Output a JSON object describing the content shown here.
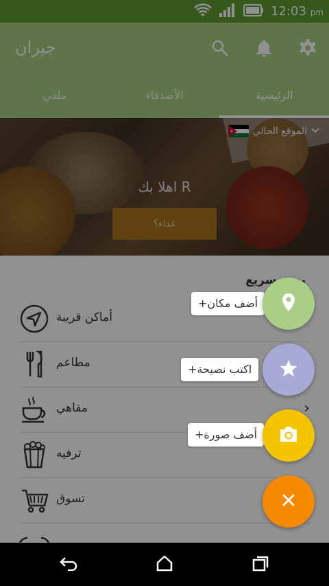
{
  "status_bar": {
    "time": "12:03",
    "ampm": "pm",
    "icons": [
      "wifi-icon",
      "signal-icon",
      "battery-icon"
    ]
  },
  "app_bar": {
    "title": "جيران",
    "actions": [
      "settings-icon",
      "notifications-icon",
      "search-icon"
    ],
    "tabs": [
      {
        "label": "ملفي",
        "active": false
      },
      {
        "label": "الأصدقاء",
        "active": false
      },
      {
        "label": "الرئيسية",
        "active": true
      }
    ]
  },
  "hero": {
    "location_label": "الموقع الحالي",
    "welcome": "اهلا بك R",
    "meal_button": "غداء؟"
  },
  "section": {
    "title": "بحث سريع",
    "items": [
      {
        "label": "أماكن قريبة",
        "icon": "navigation-arrow-icon"
      },
      {
        "label": "مطاعم",
        "icon": "fork-knife-icon"
      },
      {
        "label": "مقاهي",
        "icon": "coffee-cup-icon"
      },
      {
        "label": "ترفيه",
        "icon": "popcorn-icon"
      },
      {
        "label": "تسوق",
        "icon": "shopping-cart-icon"
      },
      {
        "label": "",
        "icon": "more-icon"
      }
    ]
  },
  "fab_menu": {
    "actions": [
      {
        "label": "+أضف مكان",
        "icon": "location-pin-icon",
        "color": "#a9cf86"
      },
      {
        "label": "+اكتب نصيحة",
        "icon": "star-icon",
        "color": "#a8aad5"
      },
      {
        "label": "+أضف صورة",
        "icon": "camera-icon",
        "color": "#f5c400"
      }
    ],
    "close_icon": "close-icon",
    "close_color": "#f58a00"
  },
  "nav_bar": {
    "buttons": [
      "back-icon",
      "home-icon",
      "recents-icon"
    ]
  },
  "colors": {
    "status_bar": "#5f9c34",
    "app_bar": "#a6ce82",
    "accent_orange": "#f58a00"
  }
}
